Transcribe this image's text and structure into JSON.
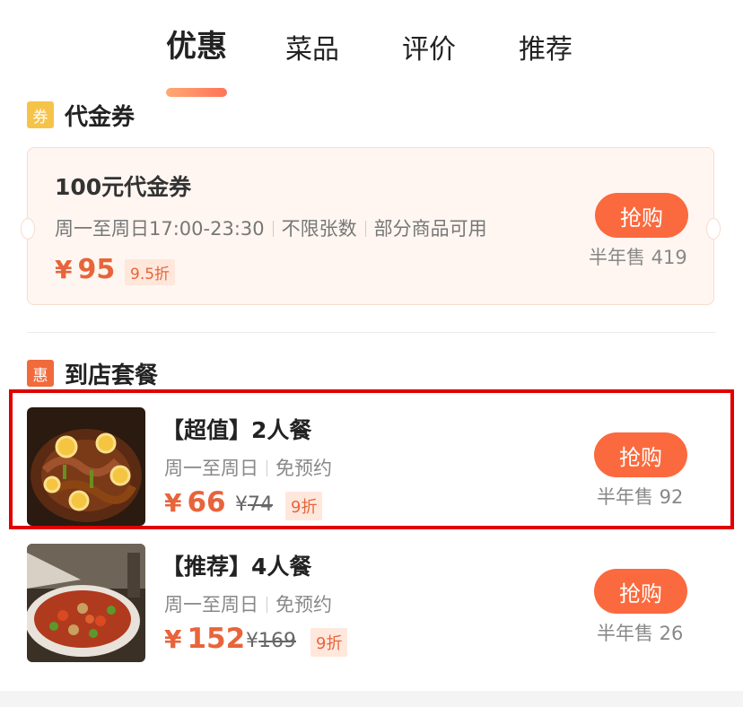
{
  "tabs": [
    {
      "label": "优惠",
      "active": true
    },
    {
      "label": "菜品",
      "active": false
    },
    {
      "label": "评价",
      "active": false
    },
    {
      "label": "推荐",
      "active": false
    }
  ],
  "voucher_section": {
    "badge": "券",
    "badge_color": "#f6c34a",
    "title": "代金券",
    "card": {
      "title": "100元代金券",
      "desc_time": "周一至周日17:00-23:30",
      "desc_limit": "不限张数",
      "desc_scope": "部分商品可用",
      "currency": "¥",
      "price": "95",
      "discount": "9.5折",
      "buy_label": "抢购",
      "sold": "半年售 419"
    }
  },
  "meal_section": {
    "badge": "惠",
    "badge_color": "#f06a3c",
    "title": "到店套餐",
    "items": [
      {
        "title": "【超值】2人餐",
        "desc_days": "周一至周日",
        "desc_booking": "免预约",
        "currency": "¥",
        "price": "66",
        "orig_currency": "¥",
        "orig_price": "74",
        "discount": "9折",
        "buy_label": "抢购",
        "sold": "半年售 92",
        "image": "chicken-feet-lemon-dish-photo",
        "highlighted": true
      },
      {
        "title": "【推荐】4人餐",
        "desc_days": "周一至周日",
        "desc_booking": "免预约",
        "currency": "¥",
        "price": "152",
        "orig_currency": "¥",
        "orig_price": "169",
        "discount": "9折",
        "buy_label": "抢购",
        "sold": "半年售 26",
        "image": "spicy-chili-chicken-dish-photo",
        "highlighted": false
      }
    ]
  },
  "colors": {
    "accent": "#fa6a3e",
    "price": "#e8643a",
    "highlight_border": "#e00000"
  }
}
